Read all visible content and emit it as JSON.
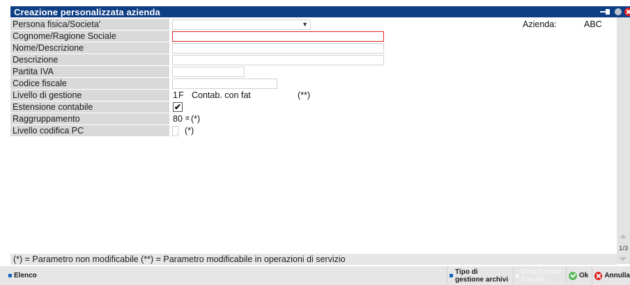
{
  "window": {
    "title": "Creazione personalizzata azienda"
  },
  "header": {
    "azienda_label": "Azienda:",
    "azienda_value": "ABC"
  },
  "form": {
    "persona_label": "Persona fisica/Societa'",
    "persona_value": "",
    "cognome_label": "Cognome/Ragione Sociale",
    "cognome_value": "",
    "nome_label": "Nome/Descrizione",
    "nome_value": "",
    "descrizione_label": "Descrizione",
    "descrizione_value": "",
    "partita_iva_label": "Partita IVA",
    "partita_iva_value": "",
    "codice_fiscale_label": "Codice fiscale",
    "codice_fiscale_value": "",
    "livello_gestione_label": "Livello di gestione",
    "livello_gestione_value": "1F",
    "livello_gestione_desc": "Contab. con fat",
    "livello_gestione_note": "(**)",
    "estensione_label": "Estensione contabile",
    "estensione_checked": "✔",
    "raggruppamento_label": "Raggruppamento",
    "raggruppamento_value": "80",
    "raggruppamento_marker": "≡",
    "raggruppamento_note": "(*)",
    "livello_codifica_label": "Livello codifica PC",
    "livello_codifica_value": "",
    "livello_codifica_note": "(*)"
  },
  "footer_note": "(*) = Parametro non modificabile   (**) = Parametro modificabile in operazioni di servizio",
  "scroll": {
    "page_indicator": "1/3"
  },
  "buttons": {
    "elenco": "Elenco",
    "tipo_line1": "Tipo di",
    "tipo_line2": "gestione archivi",
    "crea_line1": "Crea Codice",
    "crea_line2": "Fiscale",
    "ok": "Ok",
    "annulla": "Annulla"
  },
  "colors": {
    "titlebar": "#0e3f86",
    "label_bg": "#d9d9d9",
    "required_border": "#dd2222",
    "accent": "#1560c0"
  }
}
